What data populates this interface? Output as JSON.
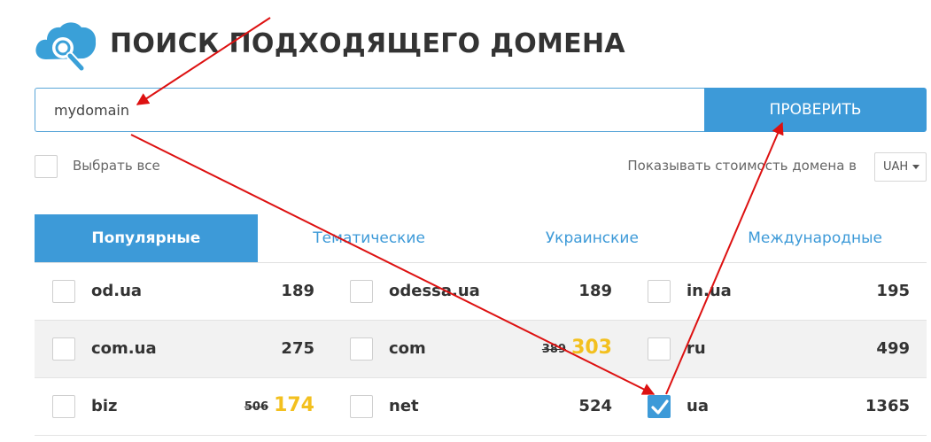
{
  "header": {
    "title": "ПОИСК ПОДХОДЯЩЕГО ДОМЕНА",
    "logo_icon": "cloud-search-icon"
  },
  "search": {
    "value": "mydomain",
    "button_label": "ПРОВЕРИТЬ"
  },
  "options": {
    "select_all_label": "Выбрать все",
    "currency_label": "Показывать стоимость домена в",
    "currency_value": "UAH"
  },
  "tabs": [
    {
      "label": "Популярные",
      "active": true
    },
    {
      "label": "Тематические",
      "active": false
    },
    {
      "label": "Украинские",
      "active": false
    },
    {
      "label": "Международные",
      "active": false
    }
  ],
  "domains": [
    [
      {
        "name": "od.ua",
        "price": "189",
        "checked": false
      },
      {
        "name": "odessa.ua",
        "price": "189",
        "checked": false
      },
      {
        "name": "in.ua",
        "price": "195",
        "checked": false
      }
    ],
    [
      {
        "name": "com.ua",
        "price": "275",
        "checked": false
      },
      {
        "name": "com",
        "old_price": "389",
        "sale_price": "303",
        "checked": false
      },
      {
        "name": "ru",
        "price": "499",
        "checked": false
      }
    ],
    [
      {
        "name": "biz",
        "old_price": "506",
        "sale_price": "174",
        "checked": false
      },
      {
        "name": "net",
        "price": "524",
        "checked": false
      },
      {
        "name": "ua",
        "price": "1365",
        "checked": true
      }
    ]
  ],
  "colors": {
    "accent": "#3d9ad8",
    "sale": "#f3c01f",
    "annotation_arrow": "#dd1111"
  }
}
